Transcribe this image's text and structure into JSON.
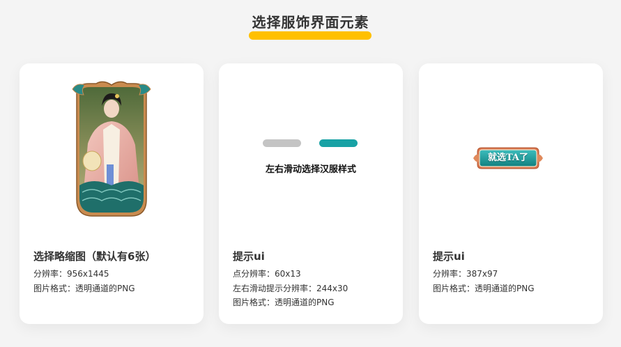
{
  "header": {
    "title": "选择服饰界面元素"
  },
  "colors": {
    "accent_underline": "#ffc000",
    "teal": "#18a2a5",
    "pill_grey": "#c4c4c4",
    "card_background": "#ffffff",
    "page_background": "#f4f4f4"
  },
  "cards": [
    {
      "heading": "选择略缩图（默认有6张）",
      "lines": [
        "分辨率：956x1445",
        "图片格式：透明通道的PNG"
      ],
      "preview": "hanfu-portrait-thumbnail-with-ornate-frame"
    },
    {
      "heading": "提示ui",
      "lines": [
        "点分辨率：60x13",
        "左右滑动提示分辨率：244x30",
        "图片格式：透明通道的PNG"
      ],
      "preview": {
        "dots": [
          "inactive",
          "active"
        ],
        "hint": "左右滑动选择汉服样式"
      }
    },
    {
      "heading": "提示ui",
      "lines": [
        "分辨率：387x97",
        "图片格式：透明通道的PNG"
      ],
      "preview": {
        "button_label": "就选TA了"
      }
    }
  ]
}
